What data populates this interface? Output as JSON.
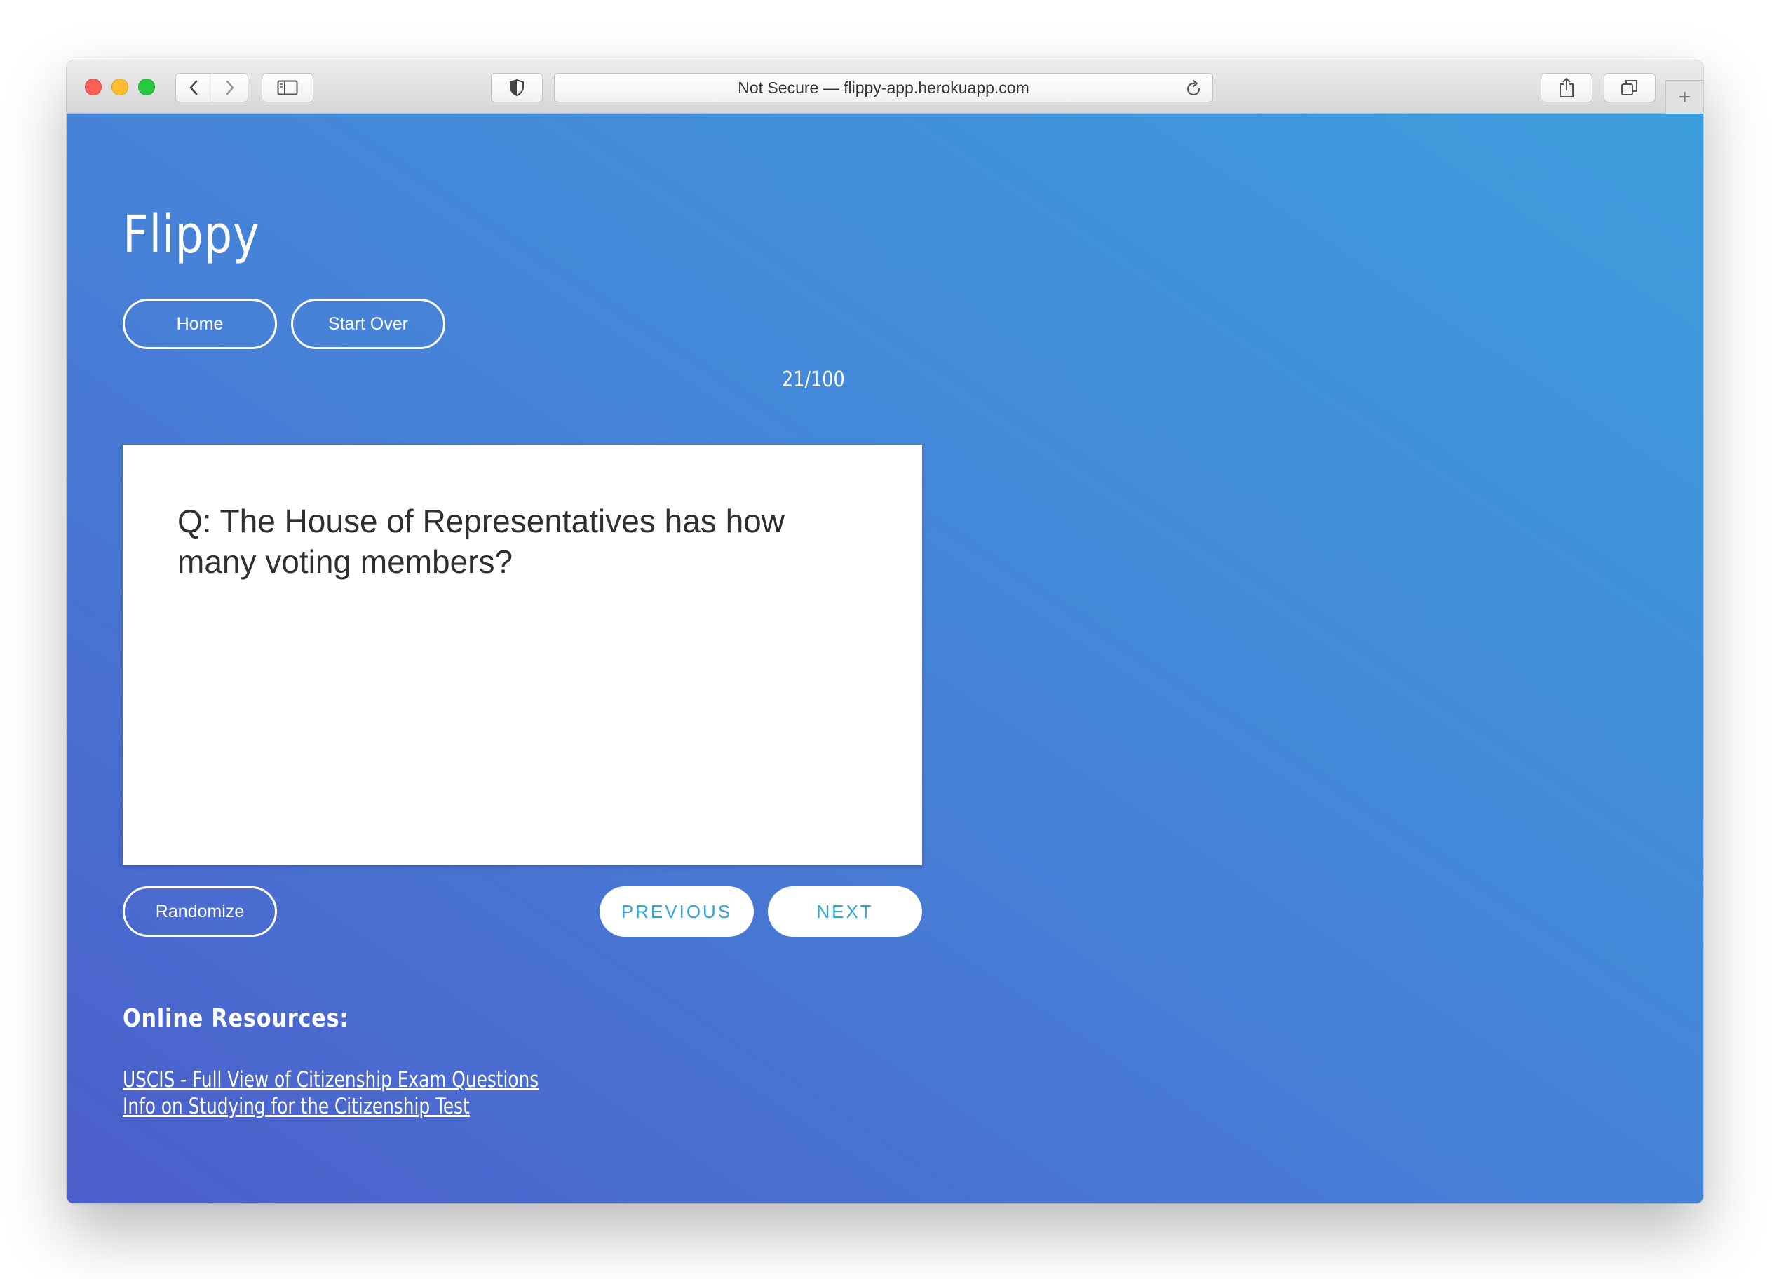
{
  "browser": {
    "address_bar": "Not Secure — flippy-app.herokuapp.com",
    "icons": {
      "back": "chevron-left-icon",
      "forward": "chevron-right-icon",
      "sidebar": "sidebar-icon",
      "privacy": "shield-icon",
      "reload": "reload-icon",
      "share": "share-icon",
      "tabs": "tabs-icon",
      "new_tab": "plus-icon"
    },
    "new_tab_label": "+"
  },
  "app": {
    "title": "Flippy",
    "nav": {
      "home_label": "Home",
      "start_over_label": "Start Over"
    },
    "counter": "21/100",
    "card": {
      "question": "Q: The House of Representatives has how many voting members?"
    },
    "controls": {
      "randomize_label": "Randomize",
      "previous_label": "PREVIOUS",
      "next_label": "NEXT"
    },
    "resources": {
      "heading": "Online Resources:",
      "links": [
        "USCIS - Full View of Citizenship Exam Questions",
        "Info on Studying for the Citizenship Test"
      ]
    }
  },
  "colors": {
    "gradient_top": "#3d9edc",
    "gradient_bottom": "#4c5ecb",
    "accent": "#2ea6d9",
    "card_text": "#2f2f2f"
  }
}
